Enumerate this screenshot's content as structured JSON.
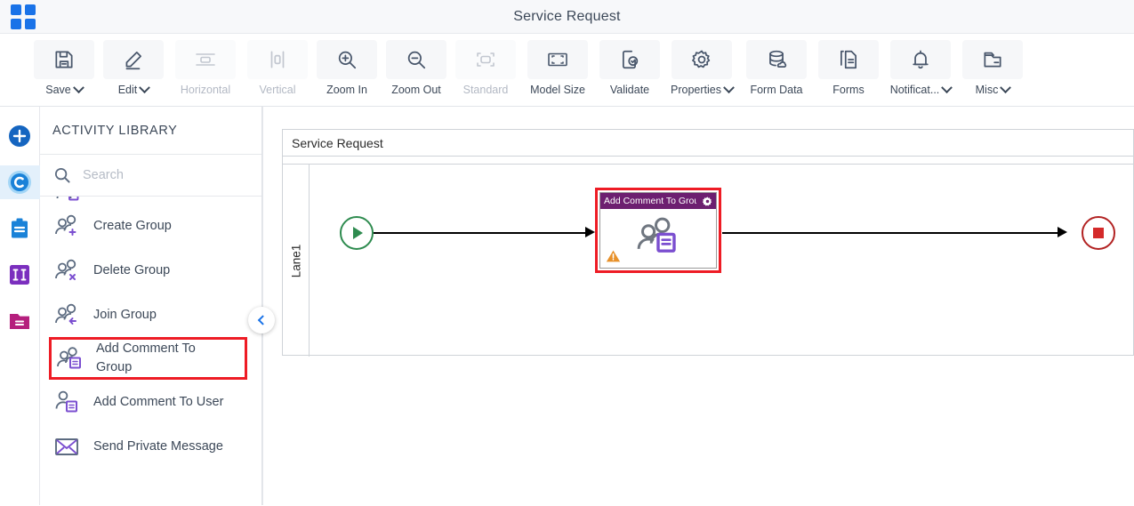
{
  "titlebar": {
    "app_title": "Service Request",
    "apps_icon": "apps-grid-icon"
  },
  "toolbar": {
    "buttons": [
      {
        "label": "Save",
        "icon": "save-icon",
        "dropdown": true,
        "disabled": false
      },
      {
        "label": "Edit",
        "icon": "pencil-icon",
        "dropdown": true,
        "disabled": false
      },
      {
        "label": "Horizontal",
        "icon": "horizontal-icon",
        "dropdown": false,
        "disabled": true
      },
      {
        "label": "Vertical",
        "icon": "vertical-icon",
        "dropdown": false,
        "disabled": true
      },
      {
        "label": "Zoom In",
        "icon": "zoom-in-icon",
        "dropdown": false,
        "disabled": false
      },
      {
        "label": "Zoom Out",
        "icon": "zoom-out-icon",
        "dropdown": false,
        "disabled": false
      },
      {
        "label": "Standard",
        "icon": "standard-icon",
        "dropdown": false,
        "disabled": true
      },
      {
        "label": "Model Size",
        "icon": "model-size-icon",
        "dropdown": false,
        "disabled": false
      },
      {
        "label": "Validate",
        "icon": "validate-icon",
        "dropdown": false,
        "disabled": false
      },
      {
        "label": "Properties",
        "icon": "gear-icon",
        "dropdown": true,
        "disabled": false
      },
      {
        "label": "Form Data",
        "icon": "database-icon",
        "dropdown": false,
        "disabled": false
      },
      {
        "label": "Forms",
        "icon": "forms-icon",
        "dropdown": false,
        "disabled": false
      },
      {
        "label": "Notificat...",
        "icon": "bell-icon",
        "dropdown": true,
        "disabled": false
      },
      {
        "label": "Misc",
        "icon": "folder-icon",
        "dropdown": true,
        "disabled": false
      }
    ]
  },
  "rail": {
    "items": [
      {
        "name": "add-icon",
        "glyph": "+",
        "color": "#1565c0",
        "shape": "circle",
        "active": false
      },
      {
        "name": "collaborate-icon",
        "glyph": "C",
        "color": "#1a82d8",
        "shape": "circle",
        "active": true
      },
      {
        "name": "clipboard-icon",
        "glyph": "",
        "color": "#1a82d8",
        "shape": "square",
        "active": false
      },
      {
        "name": "columns-icon",
        "glyph": "II",
        "color": "#7b2fbe",
        "shape": "square",
        "active": false
      },
      {
        "name": "folder-icon",
        "glyph": "=",
        "color": "#b51f7d",
        "shape": "square",
        "active": false
      }
    ]
  },
  "panel": {
    "title": "ACTIVITY LIBRARY",
    "search": {
      "value": "",
      "placeholder": "Search",
      "icon": "search-icon"
    },
    "collapse_icon": "chevron-left-icon",
    "items": [
      {
        "label": "Create Group",
        "icon": "create-group-icon",
        "selected": false
      },
      {
        "label": "Delete Group",
        "icon": "delete-group-icon",
        "selected": false
      },
      {
        "label": "Join Group",
        "icon": "join-group-icon",
        "selected": false
      },
      {
        "label": "Add Comment To Group",
        "icon": "add-comment-group-icon",
        "selected": true
      },
      {
        "label": "Add Comment To User",
        "icon": "add-comment-user-icon",
        "selected": false
      },
      {
        "label": "Send Private Message",
        "icon": "envelope-icon",
        "selected": false
      }
    ]
  },
  "canvas": {
    "pool_title": "Service Request",
    "lane_label": "Lane1",
    "start_node": {
      "name": "start-event",
      "icon": "play-icon"
    },
    "end_node": {
      "name": "end-event",
      "icon": "stop-icon"
    },
    "task": {
      "title": "Add Comment To Group...",
      "gear_icon": "gear-icon",
      "warning_icon": "warning-triangle-icon",
      "body_icon": "add-comment-group-icon",
      "selected": true
    }
  },
  "colors": {
    "accent_blue": "#1a73e8",
    "selection_red": "#ee1c25",
    "task_header_purple": "#6d1f70",
    "start_green": "#2e8b4f",
    "end_red": "#b22222",
    "warning_orange": "#e8912a",
    "icon_purple": "#7b4fd0"
  }
}
